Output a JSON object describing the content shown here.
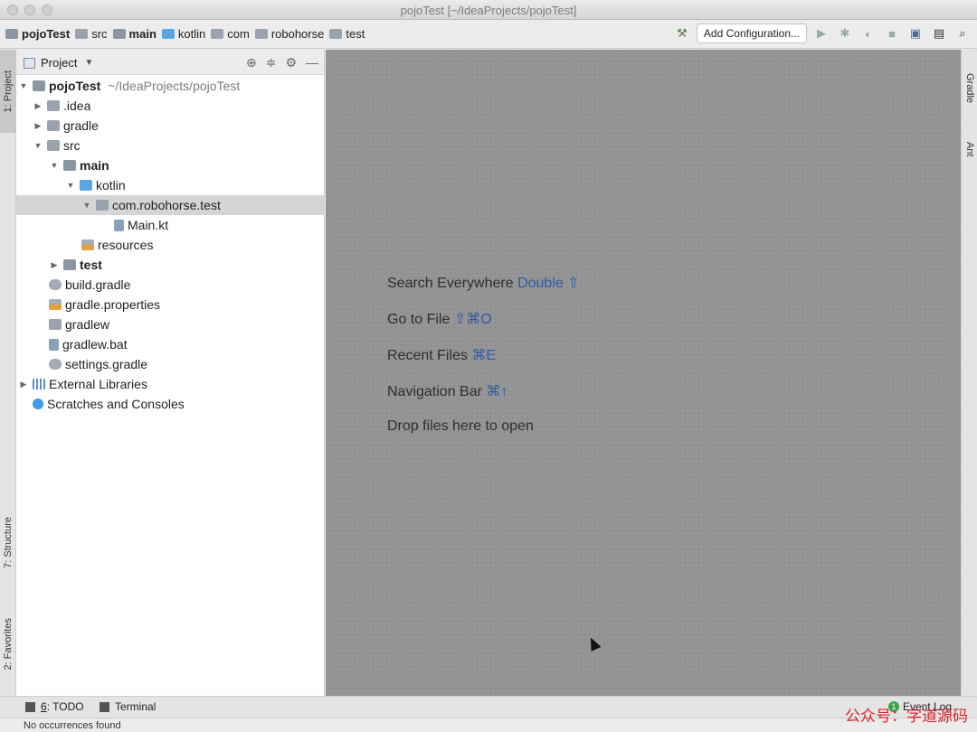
{
  "window": {
    "title": "pojoTest [~/IdeaProjects/pojoTest]"
  },
  "breadcrumbs": [
    {
      "label": "pojoTest",
      "bold": true
    },
    {
      "label": "src",
      "bold": false
    },
    {
      "label": "main",
      "bold": true
    },
    {
      "label": "kotlin",
      "bold": false
    },
    {
      "label": "com",
      "bold": false
    },
    {
      "label": "robohorse",
      "bold": false
    },
    {
      "label": "test",
      "bold": false
    }
  ],
  "toolbar": {
    "add_configuration_label": "Add Configuration..."
  },
  "left_tabs": {
    "project": "1: Project",
    "structure": "7: Structure",
    "favorites": "2: Favorites"
  },
  "right_tabs": {
    "gradle": "Gradle",
    "ant": "Ant"
  },
  "project_panel": {
    "title": "Project",
    "root": {
      "name": "pojoTest",
      "path": "~/IdeaProjects/pojoTest"
    },
    "items": {
      "idea": ".idea",
      "gradle": "gradle",
      "src": "src",
      "main": "main",
      "kotlin": "kotlin",
      "package": "com.robohorse.test",
      "mainkt": "Main.kt",
      "resources": "resources",
      "test": "test",
      "build_gradle": "build.gradle",
      "gradle_properties": "gradle.properties",
      "gradlew": "gradlew",
      "gradlew_bat": "gradlew.bat",
      "settings_gradle": "settings.gradle",
      "external_libraries": "External Libraries",
      "scratches": "Scratches and Consoles"
    }
  },
  "editor_hints": [
    {
      "text": "Search Everywhere",
      "key": "Double ⇧"
    },
    {
      "text": "Go to File",
      "key": "⇧⌘O"
    },
    {
      "text": "Recent Files",
      "key": "⌘E"
    },
    {
      "text": "Navigation Bar",
      "key": "⌘↑"
    },
    {
      "text": "Drop files here to open",
      "key": ""
    }
  ],
  "bottom_tabs": {
    "todo_num": "6",
    "todo_label": ": TODO",
    "terminal": "Terminal",
    "event_log": "Event Log",
    "event_count": "1"
  },
  "status": {
    "message": "No occurrences found"
  },
  "watermark": "公众号：字道源码"
}
